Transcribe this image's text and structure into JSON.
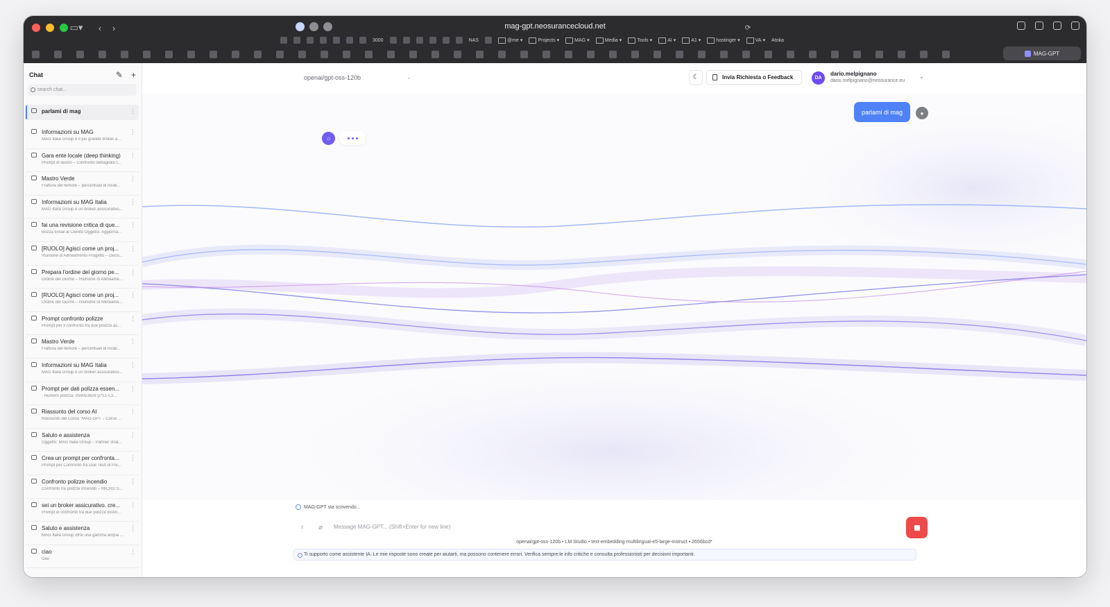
{
  "browser": {
    "url": "mag-gpt.neosurancecloud.net",
    "bookmarks": [
      "3000",
      "NAS",
      "@me",
      "Projects",
      "MAG",
      "Media",
      "Tools",
      "AI",
      "A1",
      "hostinger",
      "VA",
      "Atoka"
    ],
    "active_tab": "MAG-GPT"
  },
  "sidebar": {
    "title": "Chat",
    "search_placeholder": "search chat...",
    "chats": [
      {
        "title": "parlami di mag",
        "snippet": "",
        "active": true
      },
      {
        "title": "Informazioni su MAG",
        "snippet": "MAG Italia Group è il più grande broker a..."
      },
      {
        "title": "Gara ente locale (deep thinking)",
        "snippet": "Prompt di lavoro – Confronto dettagliato t..."
      },
      {
        "title": "Mastro Verde",
        "snippet": "Frattura del femore – percentuali di invali..."
      },
      {
        "title": "Informazioni su MAG Italia",
        "snippet": "MAG Italia Group è un broker assicurativo..."
      },
      {
        "title": "fai una revisione critica di que...",
        "snippet": "Bozza Email al Cliente Oggetto: Aggiorna..."
      },
      {
        "title": "[RUOLO] Agisci come un proj...",
        "snippet": "Riunione di Allineamento Progetto – Decis..."
      },
      {
        "title": "Prepara l'ordine del giorno pe...",
        "snippet": "Ordine del Giorno – Riunione di Allineame..."
      },
      {
        "title": "[RUOLO] Agisci come un proj...",
        "snippet": "Ordine del Giorno – Riunione di Allineame..."
      },
      {
        "title": "Prompt confronto polizze",
        "snippet": "Prompt per il confronto tra due polizze as..."
      },
      {
        "title": "Mastro Verde",
        "snippet": "Frattura del femore – percentuali di invali..."
      },
      {
        "title": "Informazioni su MAG Italia",
        "snippet": "MAG Italia Group è un broker assicurativo..."
      },
      {
        "title": "Prompt per dati polizza essen...",
        "snippet": "- Numero polizza: 059053826 [1*L1-L3..."
      },
      {
        "title": "Riassunto del corso AI",
        "snippet": "Riassunto del Corso \"MAG-GPT – Corso ..."
      },
      {
        "title": "Saluto e assistenza",
        "snippet": "Oggetto: MAG Italia Group – Partner strat..."
      },
      {
        "title": "Crea un prompt per confronta...",
        "snippet": "Prompt per Confronto tra Due Testi di Pol..."
      },
      {
        "title": "Confronto polizze incendio",
        "snippet": "Confronto tra polizze incendio – MICRO S..."
      },
      {
        "title": "sei un broker assicurativo. cre...",
        "snippet": "Prompt di confronto tra due polizze incen..."
      },
      {
        "title": "Saluto e assistenza",
        "snippet": "MAG Italia Group offre una gamma ampia ..."
      },
      {
        "title": "ciao",
        "snippet": "ciao"
      }
    ]
  },
  "header": {
    "model": "openai/gpt-oss-120b",
    "feedback_label": "Invia Richiesta o Feedback",
    "user_initials": "DA",
    "user_name": "dario.melpignano",
    "user_email": "dario.melpignano@neosurance.eu"
  },
  "conversation": {
    "user_message": "parlami di mag"
  },
  "composer": {
    "status": "MAG-GPT sta scrivendo...",
    "placeholder": "Message MAG-GPT... (Shift+Enter for new line)",
    "model_info": "openai/gpt-oss-120b • LM Studio • text-embedding-multilingual-e5-large-instruct • 2656bcd*",
    "disclaimer": "Ti supporto come assistente IA. Le mie risposte sono create per aiutarti, ma possono contenere errori. Verifica sempre le info critiche e consulta professionisti per decisioni importanti."
  },
  "colors": {
    "accent_blue": "#4f82f7",
    "accent_purple": "#6f5cf0",
    "stop_red": "#ef4a4a"
  }
}
